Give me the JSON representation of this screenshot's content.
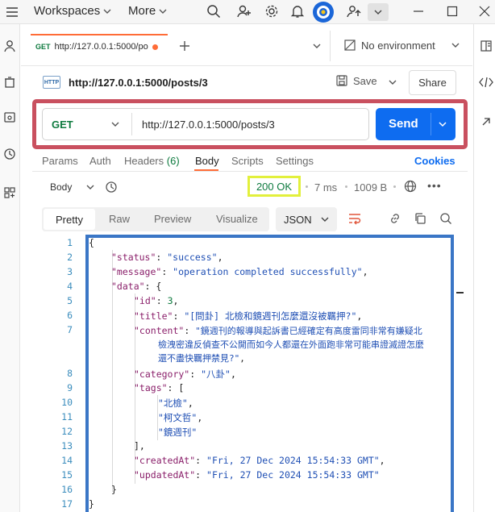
{
  "topbar": {
    "workspaces": "Workspaces",
    "more": "More"
  },
  "tab": {
    "method": "GET",
    "url": "http://127.0.0.1:5000/po",
    "environment": "No environment"
  },
  "request": {
    "title": "http://127.0.0.1:5000/posts/3",
    "save_label": "Save",
    "share_label": "Share",
    "method": "GET",
    "url": "http://127.0.0.1:5000/posts/3",
    "send_label": "Send"
  },
  "request_tabs": {
    "params": "Params",
    "auth": "Auth",
    "headers": "Headers",
    "headers_count": "(6)",
    "body": "Body",
    "scripts": "Scripts",
    "settings": "Settings",
    "cookies": "Cookies"
  },
  "response": {
    "body_label": "Body",
    "status": "200 OK",
    "time": "7 ms",
    "size": "1009 B",
    "formats": [
      "Pretty",
      "Raw",
      "Preview",
      "Visualize"
    ],
    "language": "JSON"
  },
  "code": {
    "line_numbers": [
      "1",
      "2",
      "3",
      "4",
      "5",
      "6",
      "7",
      "8",
      "9",
      "10",
      "11",
      "12",
      "13",
      "14",
      "15",
      "16",
      "17"
    ],
    "status_key": "\"status\"",
    "status_val": "\"success\"",
    "message_key": "\"message\"",
    "message_val": "\"operation completed successfully\"",
    "data_key": "\"data\"",
    "id_key": "\"id\"",
    "id_val": "3",
    "title_key": "\"title\"",
    "title_val": "\"[問卦] 北檢和鏡週刊怎麼還沒被羈押?\"",
    "content_key": "\"content\"",
    "content_line1": "\"鏡週刊的報導與起訴書已經確定有高度雷同非常有嫌疑北",
    "content_line2": "檢洩密違反偵查不公開而如今人都還在外面跑非常可能串證滅證怎麼",
    "content_line3": "還不盡快羈押禁見?\"",
    "category_key": "\"category\"",
    "category_val": "\"八卦\"",
    "tags_key": "\"tags\"",
    "tag1": "\"北檢\"",
    "tag2": "\"柯文哲\"",
    "tag3": "\"鏡週刊\"",
    "created_key": "\"createdAt\"",
    "created_val": "\"Fri, 27 Dec 2024 15:54:33 GMT\"",
    "updated_key": "\"updatedAt\"",
    "updated_val": "\"Fri, 27 Dec 2024 15:54:33 GMT\""
  },
  "colors": {
    "send": "#0e6cf0",
    "url_highlight": "#c9505f",
    "status_highlight": "#e2f03c",
    "code_highlight": "#3a76c6",
    "status_text": "#0d7a3e"
  }
}
